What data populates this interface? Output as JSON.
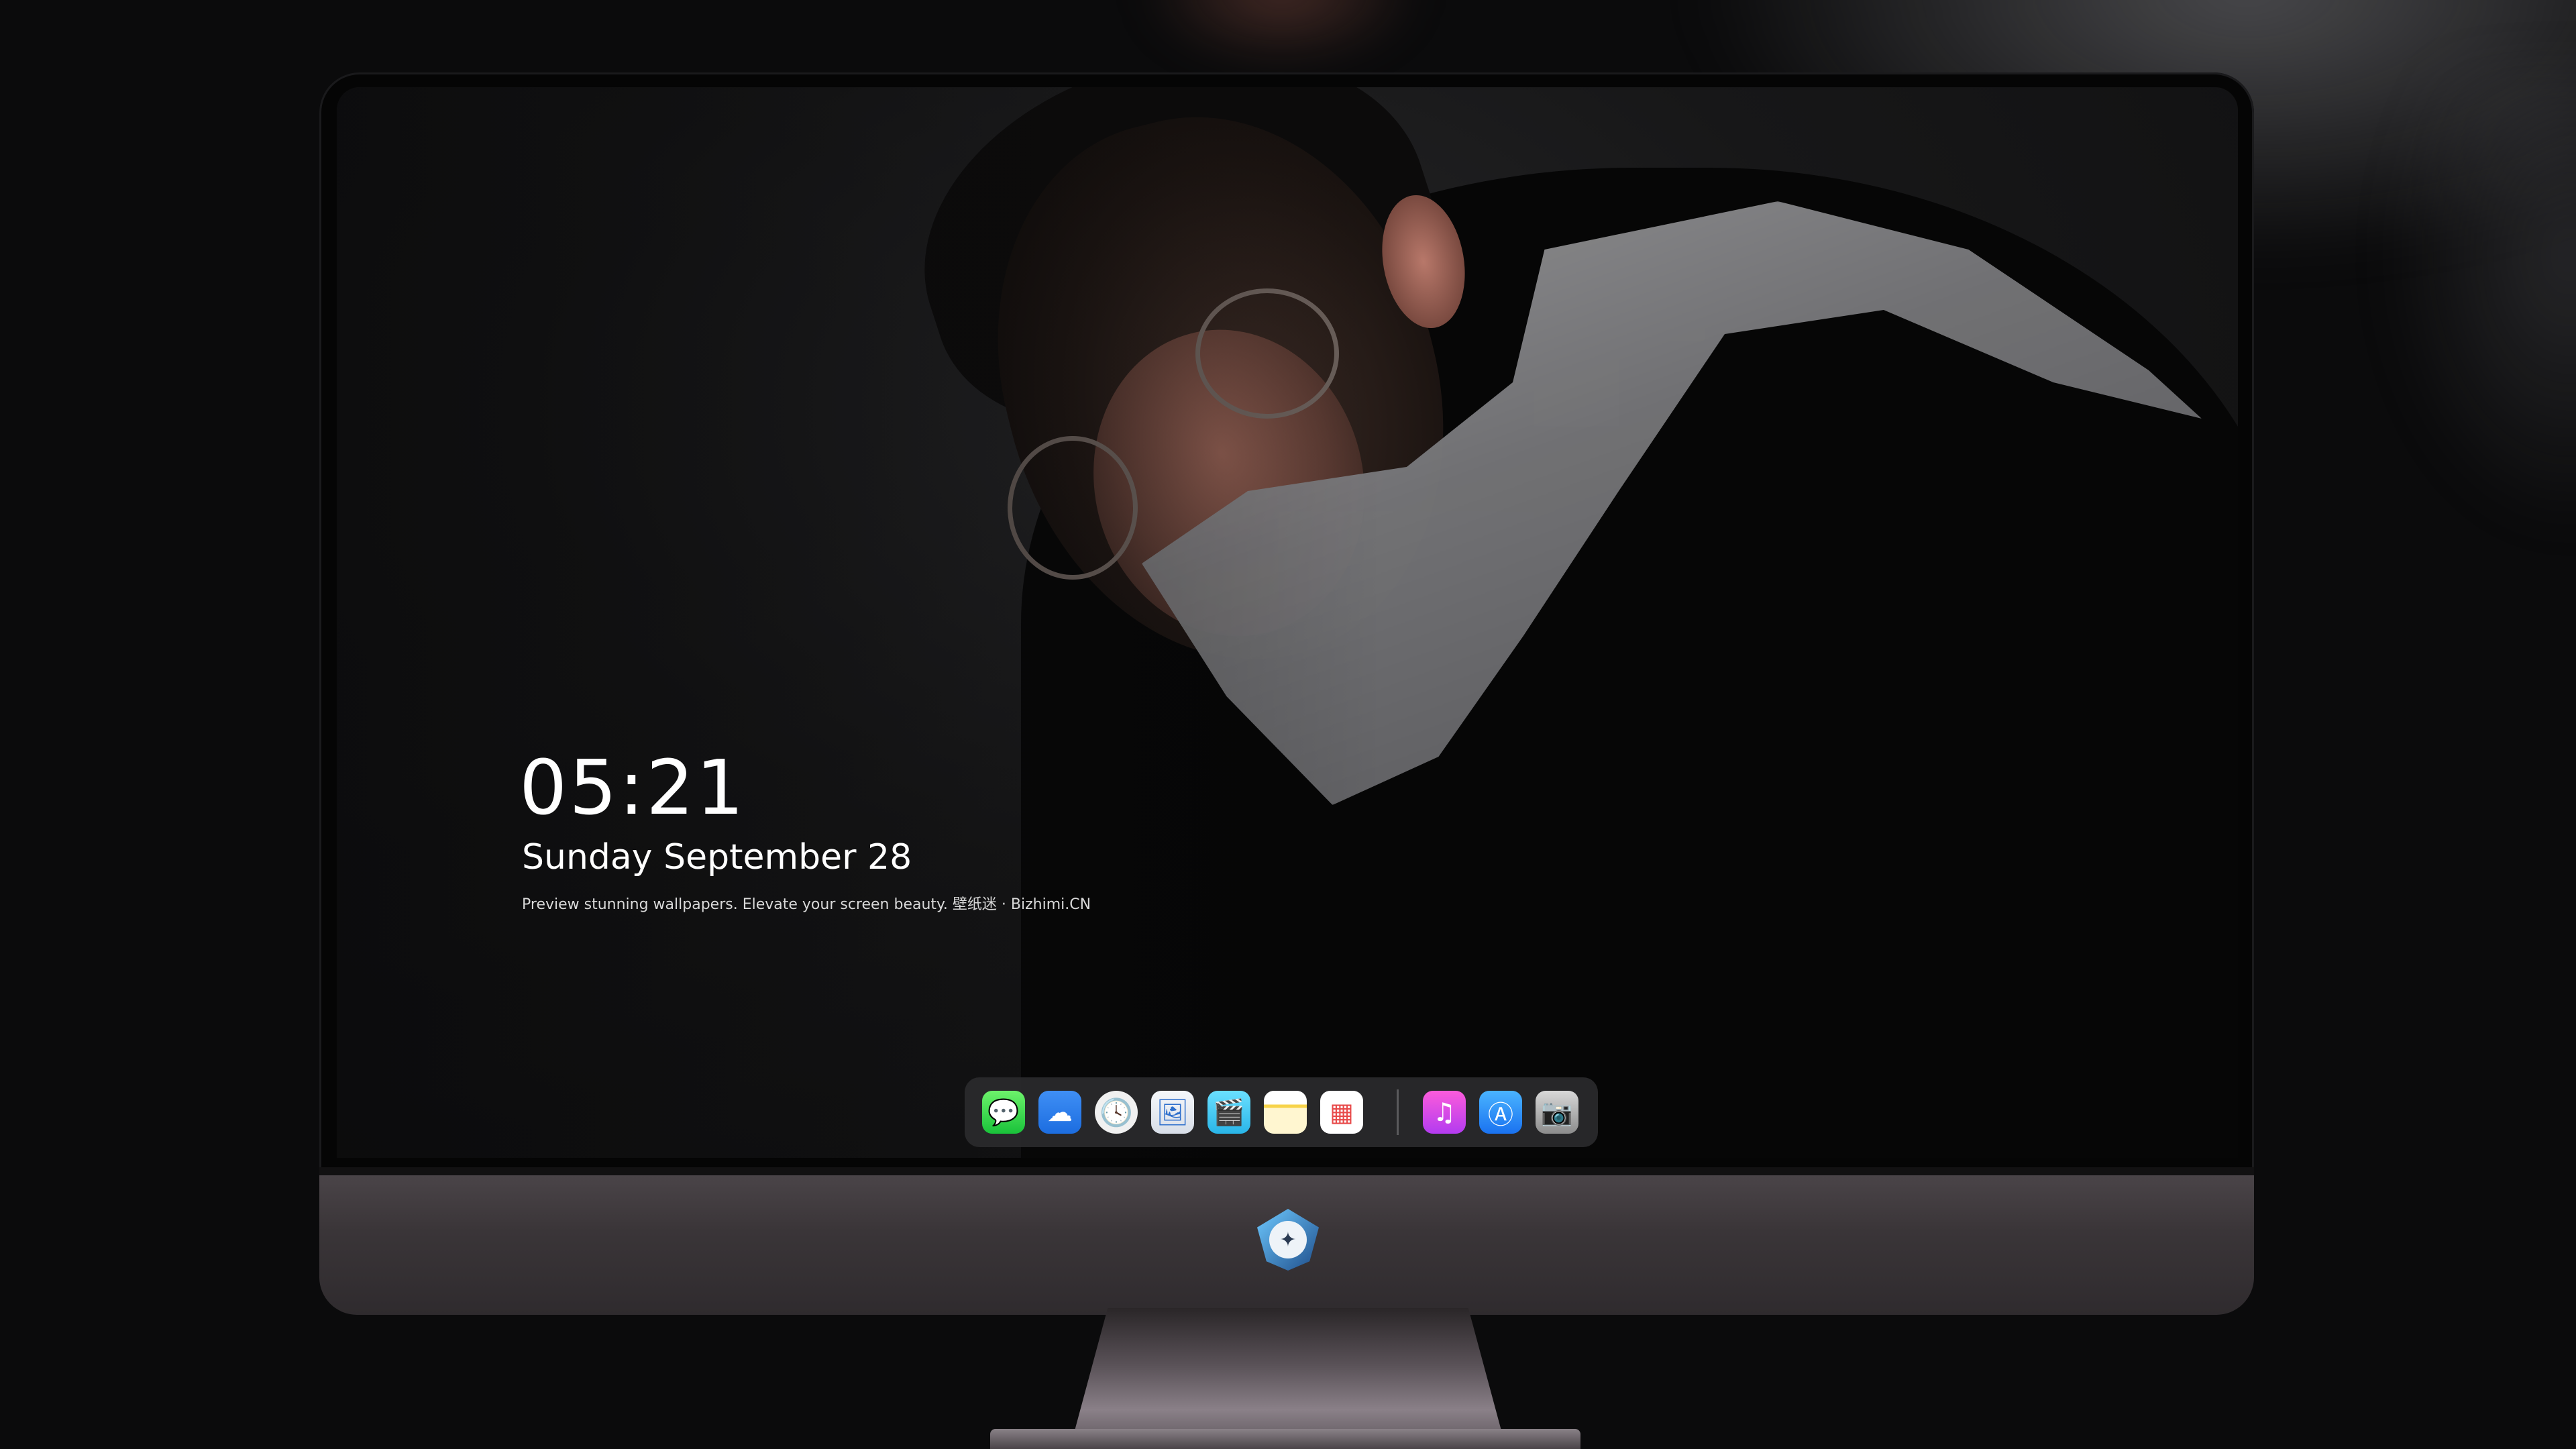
{
  "lock_screen": {
    "time": "05:21",
    "date": "Sunday September  28",
    "caption": "Preview stunning wallpapers. Elevate your screen beauty. 壁纸迷 · Bizhimi.CN"
  },
  "dock": {
    "apps_left": [
      {
        "name": "messages-icon",
        "glyph": "💬"
      },
      {
        "name": "weather-icon",
        "glyph": "☁"
      },
      {
        "name": "clock-icon",
        "glyph": "🕓"
      },
      {
        "name": "preview-icon",
        "glyph": "🖼"
      },
      {
        "name": "clips-icon",
        "glyph": "🎬"
      },
      {
        "name": "notes-icon",
        "glyph": ""
      },
      {
        "name": "photos-icon",
        "glyph": "▦"
      }
    ],
    "apps_right": [
      {
        "name": "music-icon",
        "glyph": "♫"
      },
      {
        "name": "app-store-icon",
        "glyph": "Ⓐ"
      },
      {
        "name": "camera-icon",
        "glyph": "📷"
      }
    ]
  },
  "monitor": {
    "chin_logo_icon": "bizhimi-logo-icon"
  }
}
